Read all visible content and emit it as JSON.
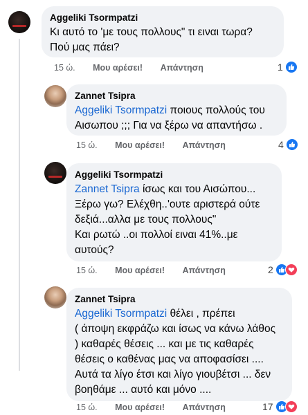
{
  "comments": [
    {
      "author": "Aggeliki Tsormpatzi",
      "text_lines": [
        "Κι αυτό το 'με τους πολλους\" τι ειναι τωρα?",
        "Πού μας πάει?"
      ],
      "time": "15 ώ.",
      "like_label": "Μου αρέσει!",
      "reply_label": "Απάντηση",
      "reaction_count": "1",
      "reactions": [
        "like-icon"
      ]
    },
    {
      "author": "Zannet Tsipra",
      "mention": "Aggeliki Tsormpatzi",
      "after_mention": " ποιους πολλούς του",
      "text_lines": [
        "Αισωπου ;;; Για να ξέρω να απαντήσω ."
      ],
      "time": "15 ώ.",
      "like_label": "Μου αρέσει!",
      "reply_label": "Απάντηση",
      "reaction_count": "4",
      "reactions": [
        "like-icon"
      ]
    },
    {
      "author": "Aggeliki Tsormpatzi",
      "mention": "Zannet Tsipra",
      "after_mention": " ίσως και του Αισώπου...",
      "text_lines": [
        "Ξέρω γω? Ελέχθη..'ουτε αριστερά ούτε",
        "δεξιά...αλλα με τους πολλους\"",
        "Και ρωτώ ..οι πολλοί ειναι 41%..με",
        "αυτούς?"
      ],
      "time": "15 ώ.",
      "like_label": "Μου αρέσει!",
      "reply_label": "Απάντηση",
      "reaction_count": "2",
      "reactions": [
        "like-icon",
        "love-icon"
      ]
    },
    {
      "author": "Zannet Tsipra",
      "mention": "Aggeliki Tsormpatzi",
      "after_mention": " θέλει , πρέπει",
      "text_lines": [
        "( άποψη εκφράζω και ίσως να κάνω λάθος",
        ") καθαρές θέσεις ... και με τις καθαρές",
        "θέσεις ο καθένας μας να αποφασίσει ....",
        "Αυτά τα λίγο έτσι και λίγο γιουβέτσι ... δεν",
        "βοηθάμε ... αυτό και μόνο ...."
      ],
      "time": "15 ώ.",
      "like_label": "Μου αρέσει!",
      "reply_label": "Απάντηση",
      "reaction_count": "17",
      "reactions": [
        "like-icon",
        "love-icon"
      ]
    }
  ],
  "colors": {
    "bubble": "#f0f2f5",
    "mention": "#1967d2",
    "like": "#1877f2",
    "love": "#f33e58",
    "meta": "#65676b"
  }
}
